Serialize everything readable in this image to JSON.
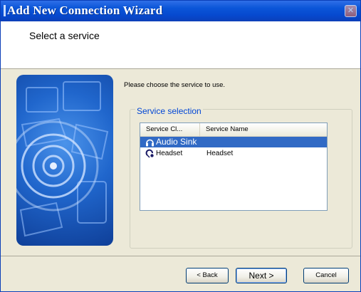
{
  "window": {
    "title": "Add New Connection Wizard"
  },
  "header": {
    "heading": "Select a service"
  },
  "content": {
    "prompt": "Please choose the service to use.",
    "group_title": "Service selection",
    "columns": [
      "Service Cl...",
      "Service Name"
    ],
    "rows": [
      {
        "icon": "headphones-icon",
        "service_class": "Audio Sink",
        "service_name": "",
        "selected": true
      },
      {
        "icon": "headset-icon",
        "service_class": "Headset",
        "service_name": "Headset",
        "selected": false
      }
    ]
  },
  "buttons": {
    "back": "< Back",
    "next": "Next >",
    "cancel": "Cancel"
  },
  "colors": {
    "title_bar": "#0b56d8",
    "selection": "#316ac5",
    "group_title": "#0046d5"
  }
}
